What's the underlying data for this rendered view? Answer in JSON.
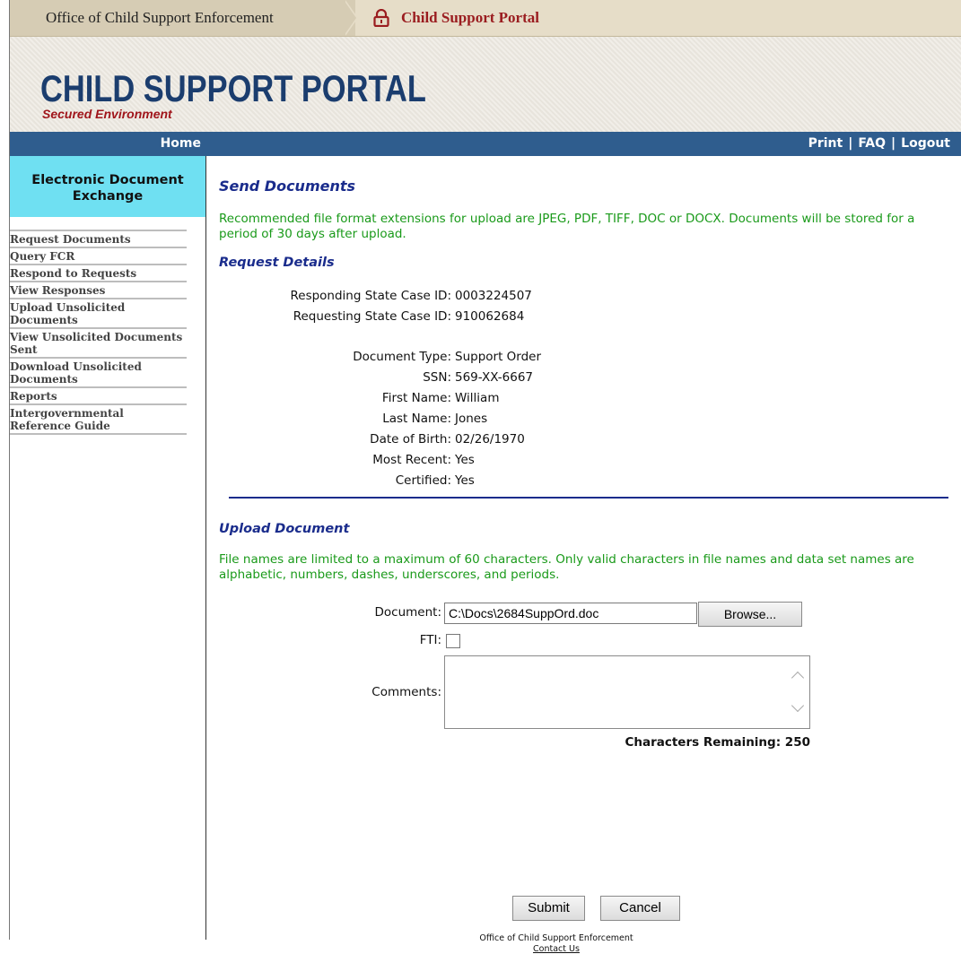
{
  "topbar": {
    "breadcrumb_1": "Office of Child Support Enforcement",
    "breadcrumb_2": "Child Support Portal"
  },
  "banner": {
    "title": "CHILD SUPPORT PORTAL",
    "subtitle": "Secured Environment"
  },
  "navbar": {
    "home": "Home",
    "print": "Print",
    "faq": "FAQ",
    "logout": "Logout",
    "separator": "|"
  },
  "sidebar": {
    "heading": "Electronic Document Exchange",
    "items": [
      "Request Documents",
      "Query FCR",
      "Respond to Requests",
      "View Responses",
      "Upload Unsolicited Documents",
      "View Unsolicited Documents Sent",
      "Download Unsolicited Documents",
      "Reports",
      "Intergovernmental Reference Guide"
    ]
  },
  "send": {
    "heading": "Send Documents",
    "note": "Recommended file format extensions for upload are JPEG, PDF, TIFF, DOC or DOCX. Documents will be stored for a period of 30 days after upload."
  },
  "request": {
    "heading": "Request Details",
    "responding_label": "Responding State Case ID:",
    "responding_value": "0003224507",
    "requesting_label": "Requesting State Case ID:",
    "requesting_value": "910062684",
    "doc_type_label": "Document Type:",
    "doc_type_value": "Support Order",
    "ssn_label": "SSN:",
    "ssn_value": "569-XX-6667",
    "first_label": "First Name:",
    "first_value": "William",
    "last_label": "Last Name:",
    "last_value": "Jones",
    "dob_label": "Date of Birth:",
    "dob_value": "02/26/1970",
    "recent_label": "Most Recent:",
    "recent_value": "Yes",
    "certified_label": "Certified:",
    "certified_value": "Yes"
  },
  "upload": {
    "heading": "Upload Document",
    "note": "File names are limited to a maximum of 60 characters. Only valid characters in file names and data set names are alphabetic, numbers, dashes, underscores, and periods.",
    "document_label": "Document:",
    "document_value": "C:\\Docs\\2684SuppOrd.doc",
    "browse_label": "Browse...",
    "fti_label": "FTI:",
    "fti_checked": false,
    "comments_label": "Comments:",
    "chars_remaining": "Characters Remaining: 250"
  },
  "actions": {
    "submit": "Submit",
    "cancel": "Cancel"
  },
  "footer": {
    "org": "Office of Child Support Enforcement",
    "contact": "Contact Us"
  }
}
